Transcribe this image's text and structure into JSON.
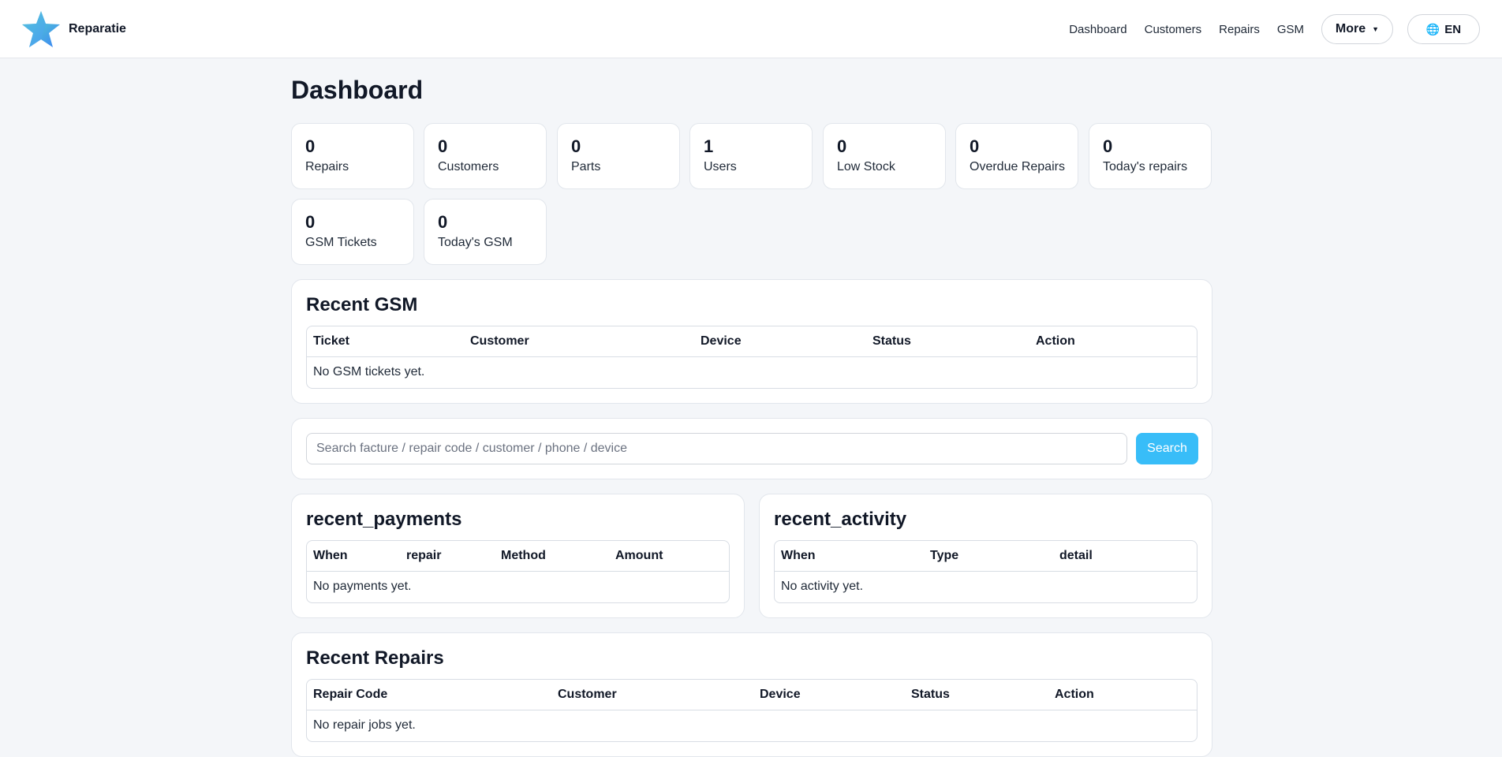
{
  "brand": {
    "name": "Reparatie",
    "logo_icon": "star-logo-icon"
  },
  "nav": {
    "links": [
      "Dashboard",
      "Customers",
      "Repairs",
      "GSM"
    ],
    "more_label": "More",
    "lang_label": "EN"
  },
  "page_title": "Dashboard",
  "stats": [
    {
      "value": "0",
      "label": "Repairs"
    },
    {
      "value": "0",
      "label": "Customers"
    },
    {
      "value": "0",
      "label": "Parts"
    },
    {
      "value": "1",
      "label": "Users"
    },
    {
      "value": "0",
      "label": "Low Stock"
    },
    {
      "value": "0",
      "label": "Overdue Repairs"
    },
    {
      "value": "0",
      "label": "Today's repairs"
    },
    {
      "value": "0",
      "label": "GSM Tickets"
    },
    {
      "value": "0",
      "label": "Today's GSM"
    }
  ],
  "recent_gsm": {
    "title": "Recent GSM",
    "columns": [
      "Ticket",
      "Customer",
      "Device",
      "Status",
      "Action"
    ],
    "empty": "No GSM tickets yet."
  },
  "search": {
    "placeholder": "Search facture / repair code / customer / phone / device",
    "button": "Search"
  },
  "recent_payments": {
    "title": "recent_payments",
    "columns": [
      "When",
      "repair",
      "Method",
      "Amount"
    ],
    "empty": "No payments yet."
  },
  "recent_activity": {
    "title": "recent_activity",
    "columns": [
      "When",
      "Type",
      "detail"
    ],
    "empty": "No activity yet."
  },
  "recent_repairs": {
    "title": "Recent Repairs",
    "columns": [
      "Repair Code",
      "Customer",
      "Device",
      "Status",
      "Action"
    ],
    "empty": "No repair jobs yet."
  },
  "colors": {
    "accent": "#38bdf8",
    "background": "#f4f6f9"
  }
}
